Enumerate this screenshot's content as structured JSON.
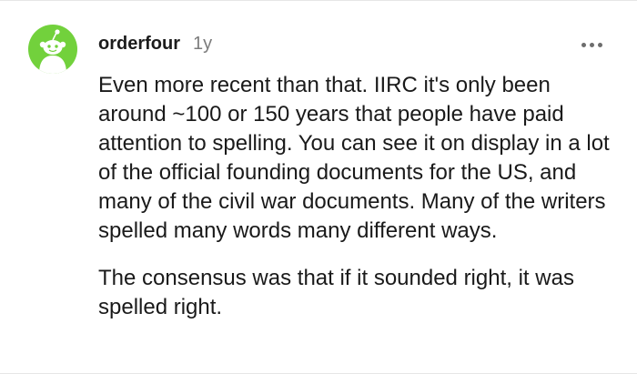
{
  "comment": {
    "username": "orderfour",
    "age": "1y",
    "paragraphs": [
      "Even more recent than that. IIRC it's only been around ~100 or 150 years that people have paid attention to spelling. You can see it on display in a lot of the official founding documents for the US, and many of the civil war documents. Many of the writers spelled many words many different ways.",
      "The consensus was that if it sounded right, it was spelled right."
    ]
  },
  "icons": {
    "avatar": "snoo-avatar-icon",
    "more": "more-options-icon"
  },
  "colors": {
    "avatar_bg": "#72d13c",
    "text": "#1a1a1a",
    "muted": "#7c7c7c"
  }
}
